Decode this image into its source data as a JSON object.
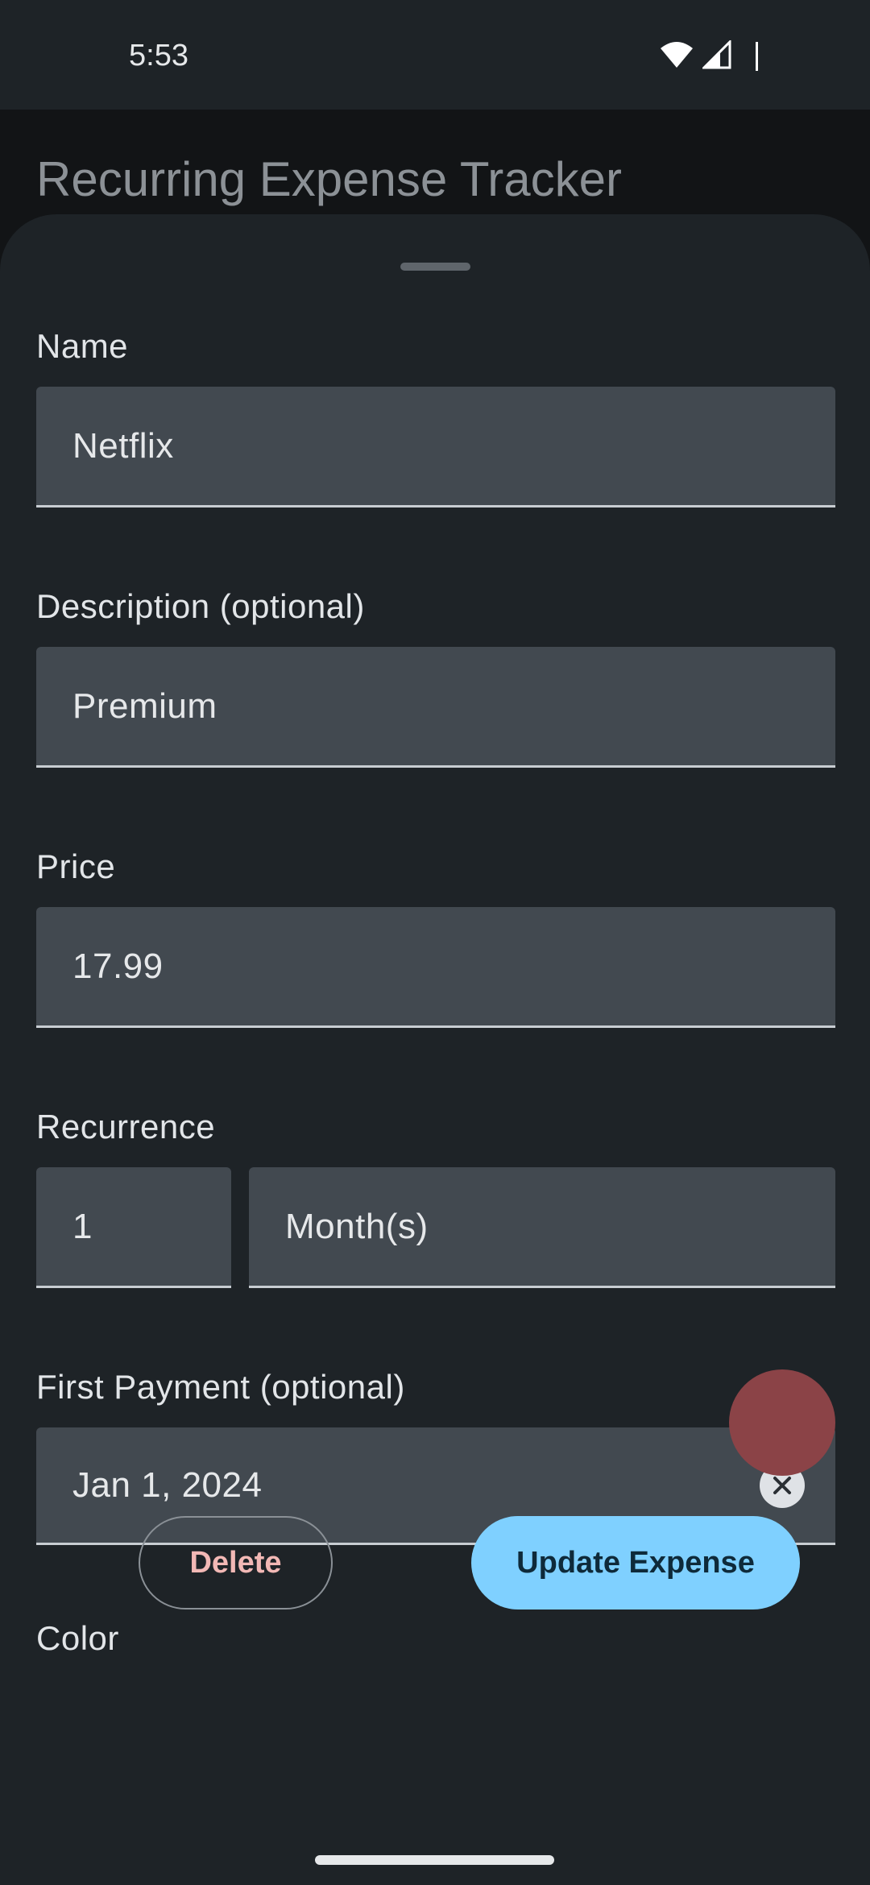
{
  "status_bar": {
    "time": "5:53",
    "icons": [
      "wifi-icon",
      "cellular-signal-icon",
      "battery-icon"
    ]
  },
  "app": {
    "title": "Recurring Expense Tracker"
  },
  "form": {
    "name": {
      "label": "Name",
      "value": "Netflix"
    },
    "description": {
      "label": "Description (optional)",
      "value": "Premium"
    },
    "price": {
      "label": "Price",
      "value": "17.99"
    },
    "recurrence": {
      "label": "Recurrence",
      "count": "1",
      "unit": "Month(s)"
    },
    "first_payment": {
      "label": "First Payment (optional)",
      "value": "Jan 1, 2024",
      "clear_icon": "close-circle-icon"
    },
    "color": {
      "label": "Color",
      "value": "#8b4347"
    }
  },
  "actions": {
    "delete_label": "Delete",
    "update_label": "Update Expense"
  },
  "colors": {
    "accent": "#7fd0ff",
    "danger_text": "#f2b8b5",
    "sheet_bg": "#1e2327",
    "field_bg": "#424950"
  }
}
